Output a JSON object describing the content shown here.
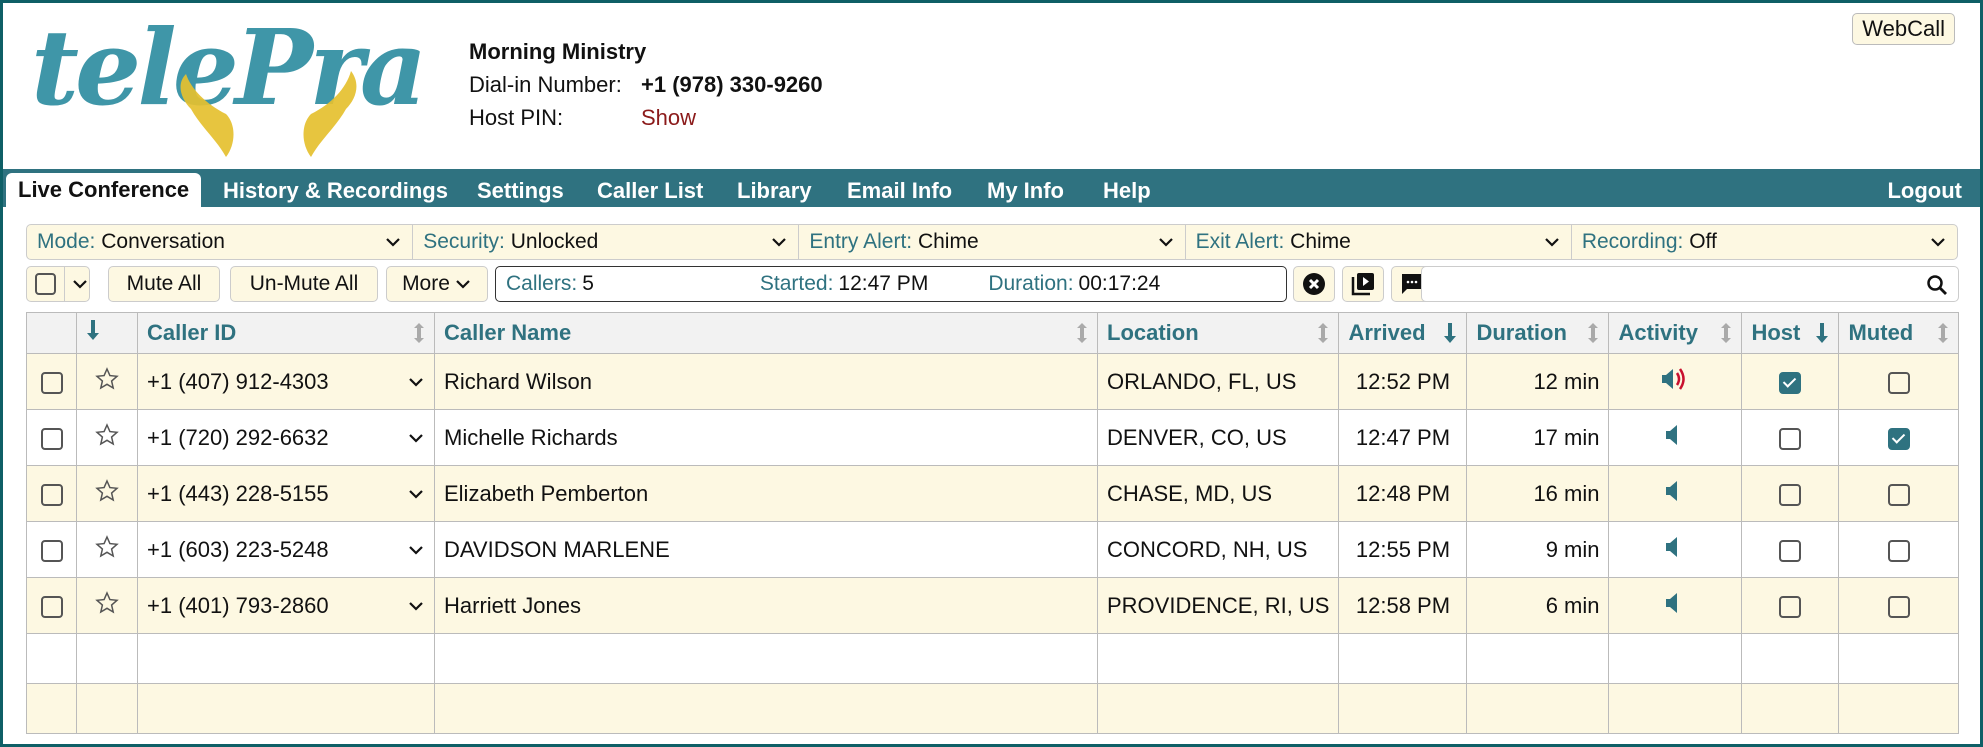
{
  "brand": {
    "logo_text": "telePray",
    "logo_icon": "praying-hands-icon"
  },
  "conference": {
    "title": "Morning Ministry",
    "dialin_label": "Dial-in Number:",
    "dialin_number": "+1 (978) 330-9260",
    "pin_label": "Host PIN:",
    "pin_action": "Show"
  },
  "webcall_label": "WebCall",
  "nav": {
    "tabs": [
      {
        "label": "Live Conference",
        "active": true
      },
      {
        "label": "History & Recordings"
      },
      {
        "label": "Settings"
      },
      {
        "label": "Caller List"
      },
      {
        "label": "Library"
      },
      {
        "label": "Email Info"
      },
      {
        "label": "My Info"
      },
      {
        "label": "Help"
      }
    ],
    "logout": "Logout"
  },
  "modes": [
    {
      "label": "Mode:",
      "value": "Conversation"
    },
    {
      "label": "Security:",
      "value": "Unlocked"
    },
    {
      "label": "Entry Alert:",
      "value": "Chime"
    },
    {
      "label": "Exit Alert:",
      "value": "Chime"
    },
    {
      "label": "Recording:",
      "value": "Off"
    }
  ],
  "toolbar": {
    "mute_all": "Mute All",
    "unmute_all": "Un-Mute All",
    "more": "More",
    "callers_label": "Callers:",
    "callers_value": "5",
    "started_label": "Started:",
    "started_value": "12:47 PM",
    "duration_label": "Duration:",
    "duration_value": "00:17:24",
    "search_value": "",
    "icons": [
      "close-circle-icon",
      "playlist-play-icon",
      "chat-bubble-icon",
      "search-icon"
    ]
  },
  "table": {
    "headers": {
      "caller_id": "Caller ID",
      "caller_name": "Caller Name",
      "location": "Location",
      "arrived": "Arrived",
      "duration": "Duration",
      "activity": "Activity",
      "host": "Host",
      "muted": "Muted"
    },
    "rows": [
      {
        "caller_id": "+1 (407) 912-4303",
        "name": "Richard Wilson",
        "location": "ORLANDO, FL, US",
        "arrived": "12:52 PM",
        "duration": "12 min",
        "activity": "speaking",
        "host": true,
        "muted": false
      },
      {
        "caller_id": "+1 (720) 292-6632",
        "name": "Michelle Richards",
        "location": "DENVER, CO, US",
        "arrived": "12:47 PM",
        "duration": "17 min",
        "activity": "silent",
        "host": false,
        "muted": true
      },
      {
        "caller_id": "+1 (443) 228-5155",
        "name": "Elizabeth Pemberton",
        "location": "CHASE, MD, US",
        "arrived": "12:48 PM",
        "duration": "16 min",
        "activity": "silent",
        "host": false,
        "muted": false
      },
      {
        "caller_id": "+1 (603) 223-5248",
        "name": "DAVIDSON MARLENE",
        "location": "CONCORD, NH, US",
        "arrived": "12:55 PM",
        "duration": "9 min",
        "activity": "silent",
        "host": false,
        "muted": false
      },
      {
        "caller_id": "+1 (401) 793-2860",
        "name": "Harriett Jones",
        "location": "PROVIDENCE, RI, US",
        "arrived": "12:58 PM",
        "duration": "6 min",
        "activity": "silent",
        "host": false,
        "muted": false
      }
    ]
  },
  "colors": {
    "teal": "#2f7280",
    "frame": "#0e5f66",
    "cream": "#fdf8e2",
    "speaking": "#c8102e",
    "logo_gold": "#e5c02f",
    "logo_teal": "#3f96a8"
  }
}
